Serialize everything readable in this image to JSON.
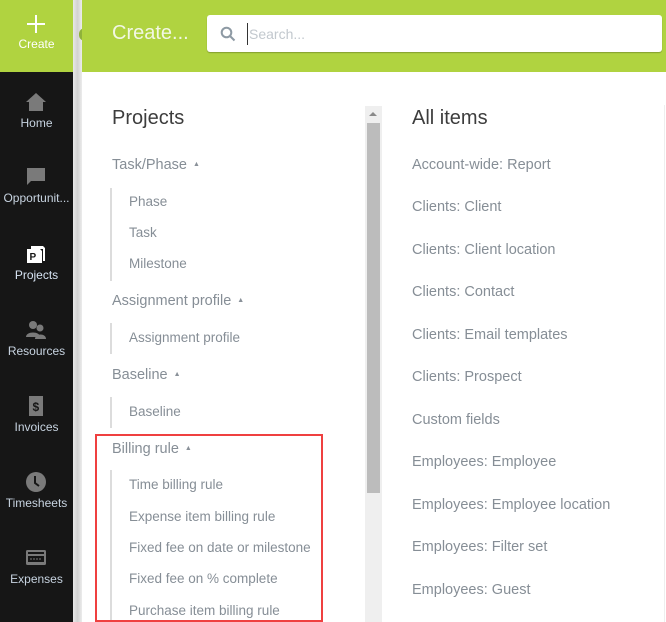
{
  "sidebar": {
    "create_label": "Create",
    "items": [
      {
        "label": "Home",
        "icon": "home-icon"
      },
      {
        "label": "Opportunit...",
        "icon": "chat-bubble-icon"
      },
      {
        "label": "Projects",
        "icon": "projects-icon",
        "active": true
      },
      {
        "label": "Resources",
        "icon": "people-icon"
      },
      {
        "label": "Invoices",
        "icon": "dollar-document-icon"
      },
      {
        "label": "Timesheets",
        "icon": "clock-icon"
      },
      {
        "label": "Expenses",
        "icon": "credit-card-icon"
      }
    ]
  },
  "header": {
    "title": "Create...",
    "search_placeholder": "Search...",
    "search_value": ""
  },
  "projects": {
    "title": "Projects",
    "groups": [
      {
        "label": "Task/Phase",
        "items": [
          "Phase",
          "Task",
          "Milestone"
        ]
      },
      {
        "label": "Assignment profile",
        "items": [
          "Assignment profile"
        ]
      },
      {
        "label": "Baseline",
        "items": [
          "Baseline"
        ]
      },
      {
        "label": "Billing rule",
        "items": [
          "Time billing rule",
          "Expense item billing rule",
          "Fixed fee on date or milestone",
          "Fixed fee on % complete",
          "Purchase item billing rule"
        ]
      }
    ],
    "caret_glyph": "▲"
  },
  "all_items": {
    "title": "All items",
    "items": [
      "Account-wide: Report",
      "Clients: Client",
      "Clients: Client location",
      "Clients: Contact",
      "Clients: Email templates",
      "Clients: Prospect",
      "Custom fields",
      "Employees: Employee",
      "Employees: Employee location",
      "Employees: Filter set",
      "Employees: Guest"
    ]
  },
  "colors": {
    "accent_green": "#b0d340",
    "sidebar_bg": "#161616",
    "highlight_border": "#ef4040",
    "text_muted": "#868e96"
  }
}
